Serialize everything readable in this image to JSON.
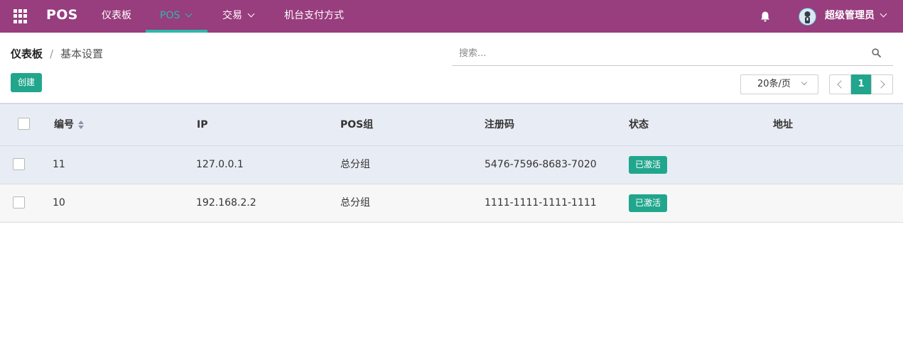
{
  "navbar": {
    "brand": "POS",
    "items": [
      {
        "label": "仪表板"
      },
      {
        "label": "POS"
      },
      {
        "label": "交易"
      },
      {
        "label": "机台支付方式"
      }
    ],
    "active_index": 1,
    "user_name": "超级管理员"
  },
  "breadcrumb": {
    "parent": "仪表板",
    "separator": "/",
    "current": "基本设置"
  },
  "search": {
    "placeholder": "搜索..."
  },
  "toolbar": {
    "create_label": "创建"
  },
  "pagination": {
    "page_size_label": "20条/页",
    "current_page": "1"
  },
  "table": {
    "columns": [
      "编号",
      "IP",
      "POS组",
      "注册码",
      "状态",
      "地址"
    ],
    "sorted_column": "编号",
    "rows": [
      {
        "id": "11",
        "ip": "127.0.0.1",
        "group": "总分组",
        "reg_code": "5476-7596-8683-7020",
        "status": "已激活",
        "address": ""
      },
      {
        "id": "10",
        "ip": "192.168.2.2",
        "group": "总分组",
        "reg_code": "1111-1111-1111-1111",
        "status": "已激活",
        "address": ""
      }
    ]
  },
  "colors": {
    "navbar_bg": "#983d7e",
    "accent": "#21a68d",
    "active_nav": "#2fb8a8",
    "table_header_bg": "#e8ecf4"
  },
  "icons": {
    "apps": "apps-grid-icon",
    "notifications": "bell-icon",
    "search": "search-icon",
    "sort": "sort-icon"
  }
}
